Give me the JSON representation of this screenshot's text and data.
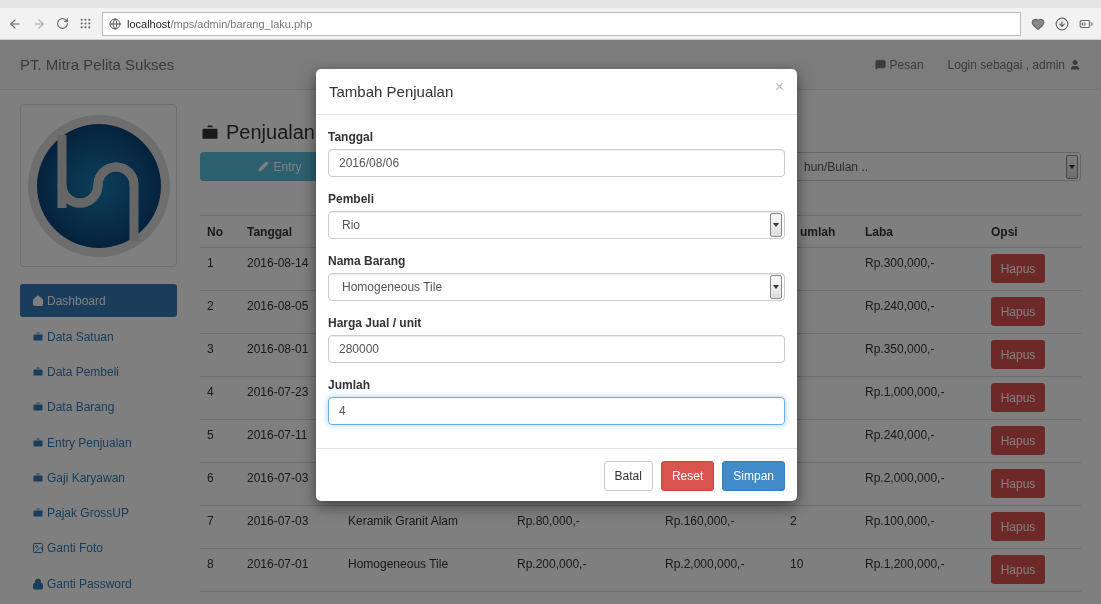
{
  "browser": {
    "url_host": "localhost",
    "url_path": "/mps/admin/barang_laku.php"
  },
  "navbar": {
    "brand": "PT. Mitra Pelita Sukses",
    "messages": "Pesan",
    "login": "Login sebagai , admin"
  },
  "sidebar": {
    "items": [
      {
        "label": "Dashboard",
        "kind": "home",
        "selected": true
      },
      {
        "label": "Data Satuan",
        "kind": "data",
        "selected": false
      },
      {
        "label": "Data Pembeli",
        "kind": "data",
        "selected": false
      },
      {
        "label": "Data Barang",
        "kind": "data",
        "selected": false
      },
      {
        "label": "Entry Penjualan",
        "kind": "data",
        "selected": false
      },
      {
        "label": "Gaji Karyawan",
        "kind": "data",
        "selected": false
      },
      {
        "label": "Pajak GrossUP",
        "kind": "data",
        "selected": false
      },
      {
        "label": "Ganti Foto",
        "kind": "photo",
        "selected": false
      },
      {
        "label": "Ganti Password",
        "kind": "password",
        "selected": false
      }
    ]
  },
  "main": {
    "title": "Penjualan",
    "entry_button": "Entry",
    "filter": "hun/Bulan .."
  },
  "table": {
    "header": {
      "no": "No",
      "tanggal": "Tanggal",
      "jumlah": "umlah",
      "laba": "Laba",
      "opsi": "Opsi"
    },
    "rows": [
      {
        "no": "1",
        "tanggal": "2016-08-14",
        "laba": "Rp.300,000,-",
        "action": "Hapus"
      },
      {
        "no": "2",
        "tanggal": "2016-08-05",
        "laba": "Rp.240,000,-",
        "action": "Hapus"
      },
      {
        "no": "3",
        "tanggal": "2016-08-01",
        "laba": "Rp.350,000,-",
        "action": "Hapus"
      },
      {
        "no": "4",
        "tanggal": "2016-07-23",
        "laba": "Rp.1,000,000,-",
        "action": "Hapus"
      },
      {
        "no": "5",
        "tanggal": "2016-07-11",
        "laba": "Rp.240,000,-",
        "action": "Hapus"
      },
      {
        "no": "6",
        "tanggal": "2016-07-03",
        "laba": "Rp.2,000,000,-",
        "action": "Hapus"
      },
      {
        "no": "7",
        "tanggal": "2016-07-03",
        "nama_barang": "Keramik Granit Alam",
        "harga": "Rp.80,000,-",
        "total": "Rp.160,000,-",
        "jumlah": "2",
        "laba": "Rp.100,000,-",
        "action": "Hapus"
      },
      {
        "no": "8",
        "tanggal": "2016-07-01",
        "nama_barang": "Homogeneous Tile",
        "harga": "Rp.200,000,-",
        "total": "Rp.2,000,000,-",
        "jumlah": "10",
        "laba": "Rp.1,200,000,-",
        "action": "Hapus"
      }
    ]
  },
  "modal": {
    "title": "Tambah Penjualan",
    "close": "×",
    "fields": [
      {
        "label": "Tanggal",
        "kind": "text",
        "value": "2016/08/06",
        "focused": false
      },
      {
        "label": "Pembeli",
        "kind": "select",
        "value": "Rio",
        "focused": false
      },
      {
        "label": "Nama Barang",
        "kind": "select",
        "value": "Homogeneous Tile",
        "focused": false
      },
      {
        "label": "Harga Jual / unit",
        "kind": "text",
        "value": "280000",
        "focused": false
      },
      {
        "label": "Jumlah",
        "kind": "text",
        "value": "4",
        "focused": true
      }
    ],
    "buttons": [
      {
        "label": "Batal",
        "kind": "default"
      },
      {
        "label": "Reset",
        "kind": "danger"
      },
      {
        "label": "Simpan",
        "kind": "primary"
      }
    ]
  }
}
